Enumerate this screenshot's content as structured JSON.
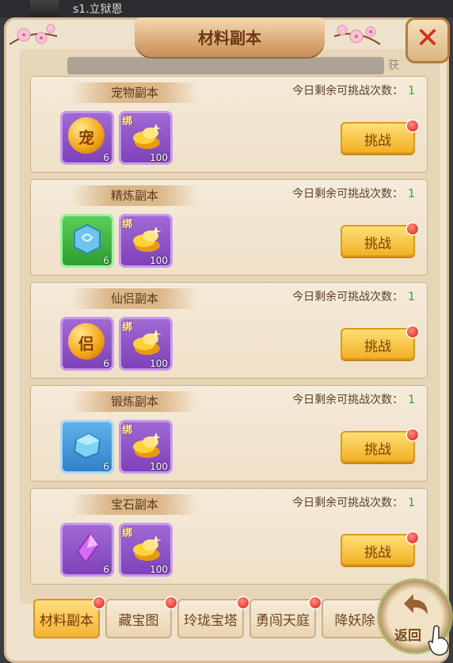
{
  "header": {
    "player_name": "s1.立狱恩",
    "title": "材料副本",
    "close_icon": "close-x-icon",
    "subtitle_tail": "获"
  },
  "dungeons": [
    {
      "name": "宠物副本",
      "remain_label": "今日剩余可挑战次数：",
      "remain_count": "1",
      "reward1": {
        "icon": "pet-coin-icon",
        "glyph": "宠",
        "count": "6",
        "frame": "purple"
      },
      "reward2": {
        "icon": "bound-gold-ingot-icon",
        "bind": "绑",
        "count": "100"
      },
      "button": "挑战"
    },
    {
      "name": "精炼副本",
      "remain_label": "今日剩余可挑战次数：",
      "remain_count": "1",
      "reward1": {
        "icon": "refine-stone-icon",
        "count": "6",
        "frame": "green"
      },
      "reward2": {
        "icon": "bound-gold-ingot-icon",
        "bind": "绑",
        "count": "100"
      },
      "button": "挑战"
    },
    {
      "name": "仙侣副本",
      "remain_label": "今日剩余可挑战次数：",
      "remain_count": "1",
      "reward1": {
        "icon": "companion-coin-icon",
        "glyph": "侣",
        "count": "6",
        "frame": "purple"
      },
      "reward2": {
        "icon": "bound-gold-ingot-icon",
        "bind": "绑",
        "count": "100"
      },
      "button": "挑战"
    },
    {
      "name": "锻炼副本",
      "remain_label": "今日剩余可挑战次数：",
      "remain_count": "1",
      "reward1": {
        "icon": "forge-stone-icon",
        "count": "6",
        "frame": "blue"
      },
      "reward2": {
        "icon": "bound-gold-ingot-icon",
        "bind": "绑",
        "count": "100"
      },
      "button": "挑战"
    },
    {
      "name": "宝石副本",
      "remain_label": "今日剩余可挑战次数：",
      "remain_count": "1",
      "reward1": {
        "icon": "purple-gem-icon",
        "count": "6",
        "frame": "purple"
      },
      "reward2": {
        "icon": "bound-gold-ingot-icon",
        "bind": "绑",
        "count": "100"
      },
      "button": "挑战"
    }
  ],
  "tabs": [
    "材料副本",
    "藏宝图",
    "玲珑宝塔",
    "勇闯天庭",
    "降妖除"
  ],
  "active_tab": 0,
  "back_button": "返回",
  "colors": {
    "accent": "#f2b131",
    "remain_count": "#2aa22a",
    "panel": "#efe2cc",
    "notify": "#e11d12"
  }
}
